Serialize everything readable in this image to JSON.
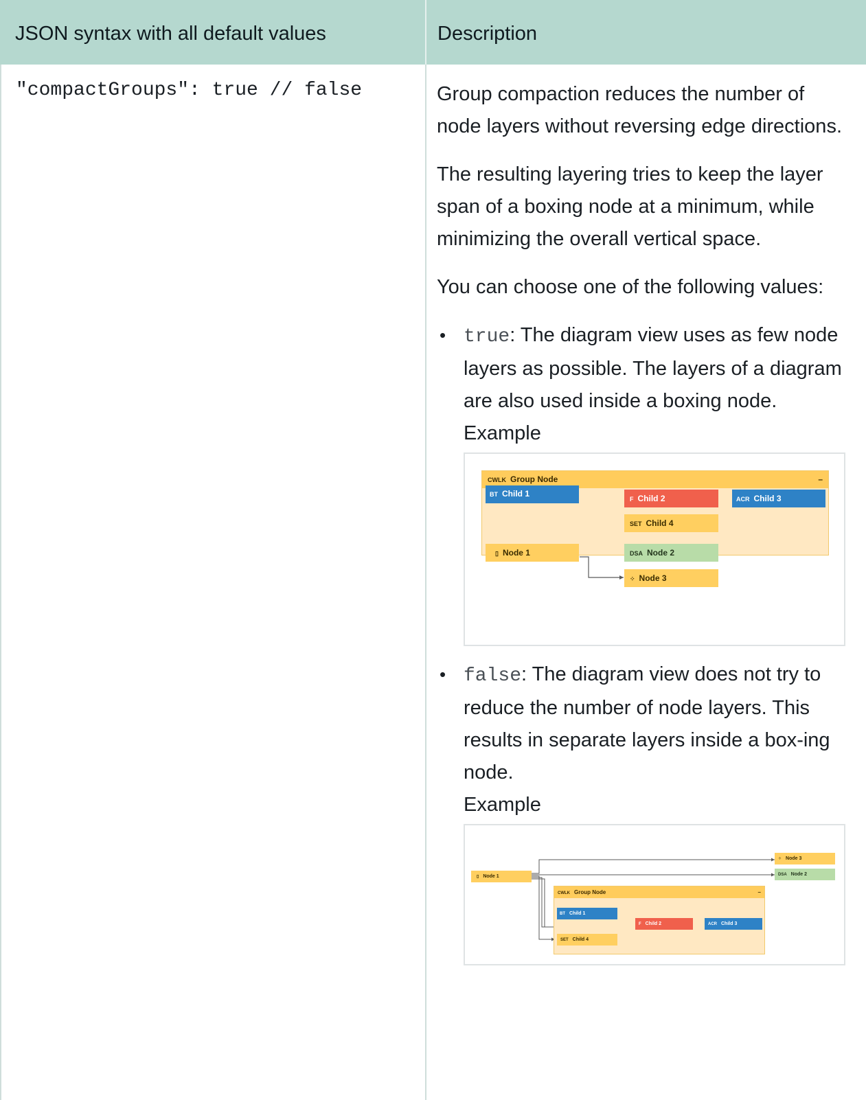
{
  "header": {
    "col1": "JSON syntax with all default values",
    "col2": "Description"
  },
  "row": {
    "syntax": "\"compactGroups\": true // false",
    "paragraphs": [
      "Group compaction reduces the number of node layers without reversing edge directions.",
      "The resulting layering tries to keep the layer span of a boxing node at a minimum, while minimizing the overall vertical space.",
      "You can choose one of the following values:"
    ],
    "options": [
      {
        "value": "true",
        "text": ": The diagram view uses as few node layers as possible. The layers of a diagram are also used inside a boxing node.",
        "example_label": "Example"
      },
      {
        "value": "false",
        "text": ": The diagram view does not try to reduce the number of node layers. This results in separate layers inside a box-ing node.",
        "example_label": "Example"
      }
    ]
  },
  "diagram": {
    "group_tag": "CWLK",
    "group_name": "Group Node",
    "collapse": "–",
    "child1_tag": "BT",
    "child1": "Child 1",
    "child2_tag": "F",
    "child2": "Child 2",
    "child3_tag": "ACR",
    "child3": "Child 3",
    "child4_tag": "SET",
    "child4": "Child 4",
    "node1": "Node 1",
    "node2_tag": "DSA",
    "node2": "Node 2",
    "node3": "Node 3"
  },
  "colors": {
    "header_bg": "#b5d8cf",
    "group_bg": "#ffe8c2",
    "group_header": "#ffcc5c",
    "blue_node": "#2e82c6",
    "red_node": "#f0604c",
    "yellow_node": "#ffcf60",
    "green_node": "#b8dca8"
  }
}
